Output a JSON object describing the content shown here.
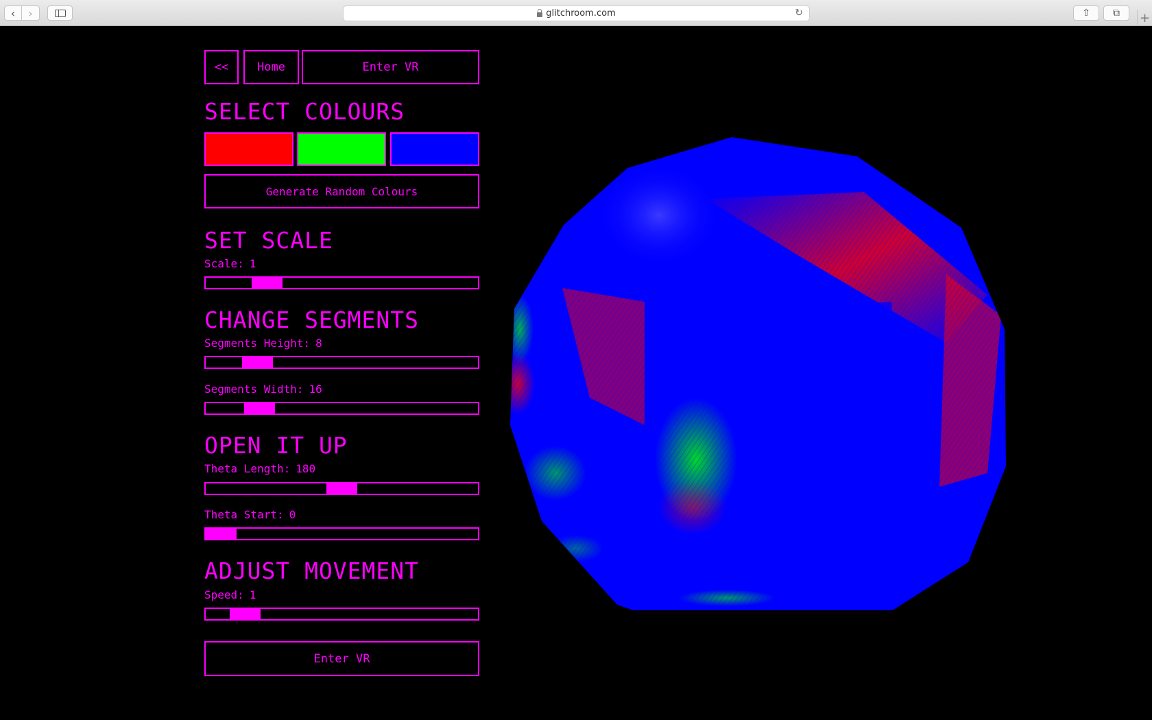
{
  "browser": {
    "url": "glitchroom.com",
    "back_glyph": "‹",
    "forward_glyph": "›",
    "reload_glyph": "↻",
    "share_glyph": "⇧",
    "tabs_glyph": "⧉",
    "newtab_glyph": "+"
  },
  "nav": {
    "back_label": "<<",
    "home_label": "Home",
    "vr_label": "Enter VR"
  },
  "colours": {
    "heading": "SELECT COLOURS",
    "swatches": [
      "#ff0000",
      "#00ff00",
      "#0000ff"
    ],
    "random_label": "Generate Random Colours"
  },
  "scale": {
    "heading": "SET SCALE",
    "label": "Scale:",
    "value": "1",
    "position": 0.19
  },
  "segments": {
    "heading": "CHANGE SEGMENTS",
    "height_label": "Segments Height:",
    "height_value": "8",
    "height_position": 0.15,
    "width_label": "Segments Width:",
    "width_value": "16",
    "width_position": 0.16
  },
  "open": {
    "heading": "OPEN IT UP",
    "length_label": "Theta Length:",
    "length_value": "180",
    "length_position": 0.5,
    "start_label": "Theta Start:",
    "start_value": "0",
    "start_position": 0.0
  },
  "movement": {
    "heading": "ADJUST MOVEMENT",
    "speed_label": "Speed:",
    "speed_value": "1",
    "speed_position": 0.1
  },
  "footer": {
    "vr_label": "Enter VR"
  },
  "accent": "#ff00ff"
}
